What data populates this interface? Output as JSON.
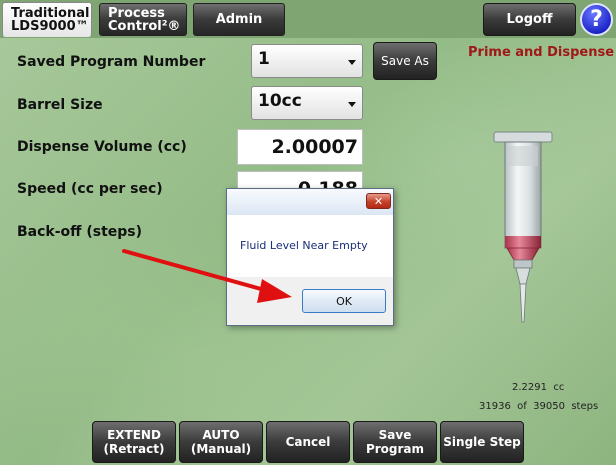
{
  "tabs": [
    {
      "line1": "Traditional",
      "line2": "LDS9000™"
    },
    {
      "line1": "Process",
      "line2": "Control²®"
    },
    {
      "line1": "Admin"
    }
  ],
  "logoff_label": "Logoff",
  "help_label": "?",
  "mode_title": "Prime and Dispense",
  "fields": {
    "saved_program_label": "Saved Program Number",
    "saved_program_value": "1",
    "save_as_label": "Save As",
    "barrel_label": "Barrel Size",
    "barrel_value": "10cc",
    "volume_label": "Dispense Volume (cc)",
    "volume_value": "2.00007",
    "speed_label": "Speed (cc per sec)",
    "speed_value": "0.188",
    "backoff_label": "Back-off (steps)"
  },
  "dialog": {
    "message": "Fluid Level Near Empty",
    "ok_label": "OK",
    "close_label": "✕"
  },
  "readouts": {
    "volume": "2.2291",
    "volume_unit": "cc",
    "steps_current": "31936",
    "steps_of": "of",
    "steps_total": "39050",
    "steps_unit": "steps"
  },
  "bottom_buttons": [
    {
      "line1": "EXTEND",
      "line2": "(Retract)"
    },
    {
      "line1": "AUTO",
      "line2": "(Manual)"
    },
    {
      "line1": "Cancel"
    },
    {
      "line1": "Save",
      "line2": "Program"
    },
    {
      "line1": "Single Step"
    }
  ],
  "colors": {
    "accent_red": "#a01818",
    "background_green": "#93bb86",
    "arrow_red": "#e01010"
  }
}
